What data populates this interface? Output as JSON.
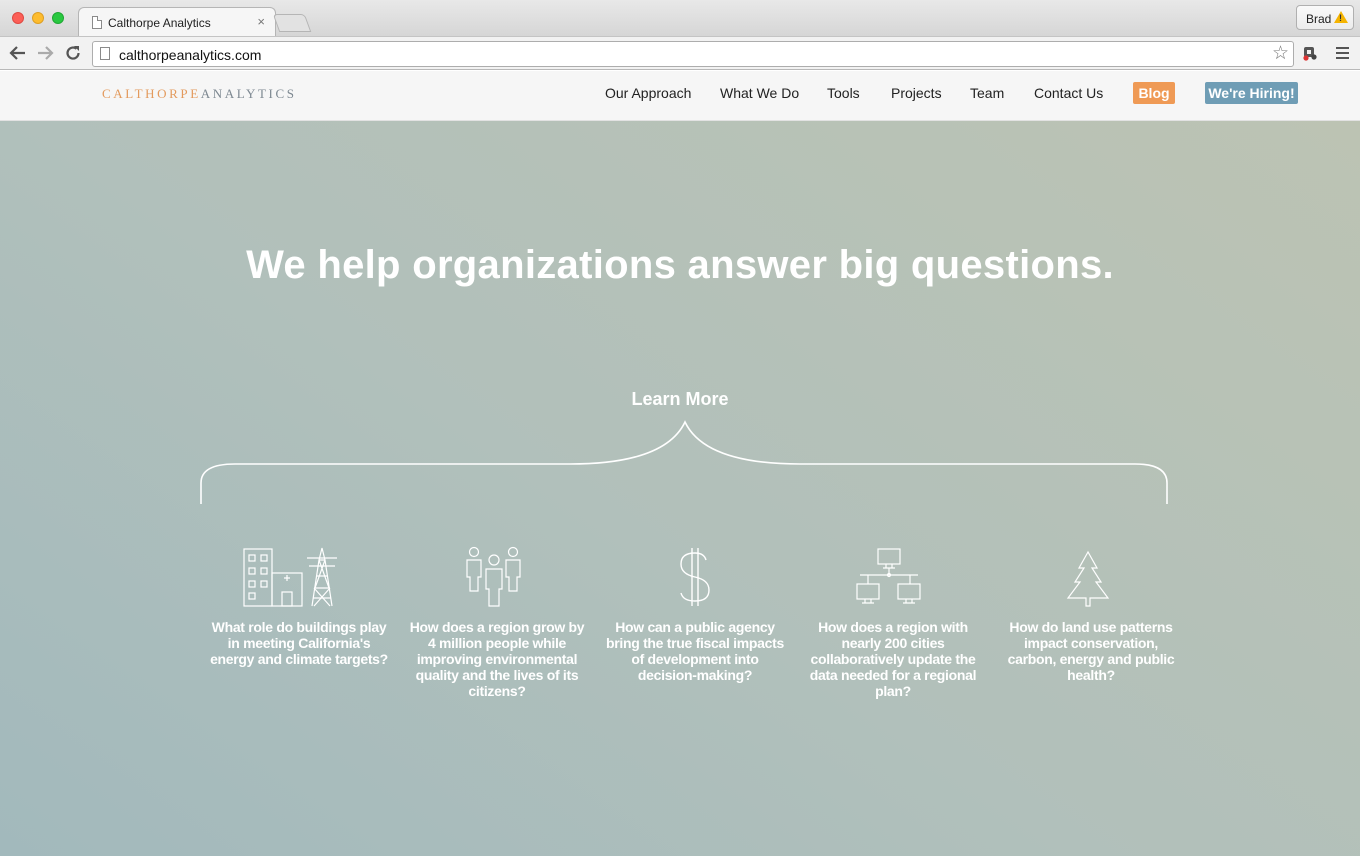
{
  "browser": {
    "tab_title": "Calthorpe Analytics",
    "tab_close": "×",
    "url": "calthorpeanalytics.com",
    "profile_name": "Brad",
    "star": "☆"
  },
  "site": {
    "logo_part1": "CALTHORPE",
    "logo_part2": "ANALYTICS",
    "nav": [
      {
        "label": "Our Approach"
      },
      {
        "label": "What We Do"
      },
      {
        "label": "Tools"
      },
      {
        "label": "Projects"
      },
      {
        "label": "Team"
      },
      {
        "label": "Contact Us"
      }
    ],
    "blog_label": "Blog",
    "hiring_label": "We're Hiring!",
    "colors": {
      "logo_accent": "#e39a5d",
      "blog": "#ef9a55",
      "hiring": "#6f9db5"
    }
  },
  "hero": {
    "title": "We help organizations answer big questions.",
    "learn_more": "Learn More",
    "questions": [
      {
        "icon": "buildings-tower-icon",
        "text": "What role do buildings play in meeting California's energy and climate targets?"
      },
      {
        "icon": "people-icon",
        "text": "How does a region grow by 4 million people while improving environmental quality and the lives of its citizens?"
      },
      {
        "icon": "dollar-icon",
        "text": "How can a public agency bring the true fiscal impacts of development into decision-making?"
      },
      {
        "icon": "network-computers-icon",
        "text": "How does a region with nearly 200 cities collaboratively update the data needed for a regional plan?"
      },
      {
        "icon": "tree-icon",
        "text": "How do land use patterns impact conservation, carbon, energy and public health?"
      }
    ]
  }
}
